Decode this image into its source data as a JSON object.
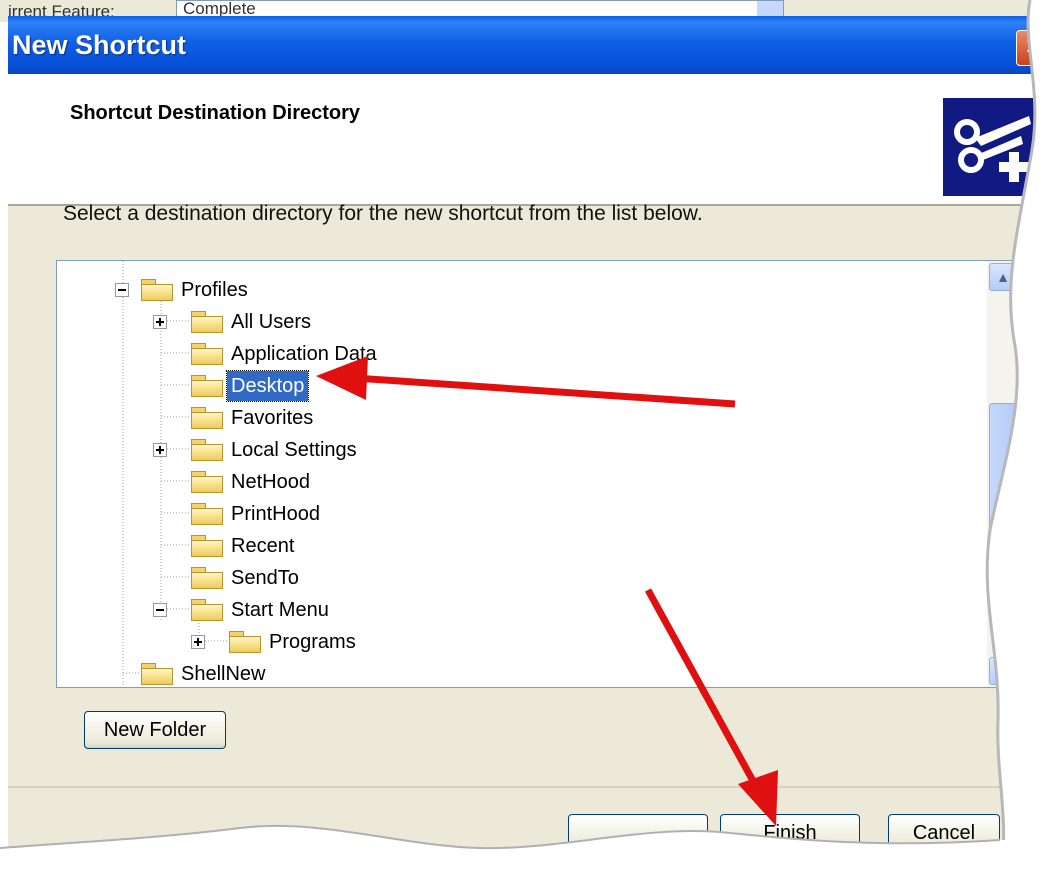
{
  "background": {
    "label": "irrent Feature:",
    "combo_value": "Complete"
  },
  "window": {
    "title": "New Shortcut",
    "close_glyph": "✕"
  },
  "header": {
    "title": "Shortcut Destination Directory",
    "icon": "shortcut-scissors-plus-icon"
  },
  "instruction": "Select a destination directory for the new shortcut from the list below.",
  "tree": {
    "nodes": [
      {
        "label": "Profiles",
        "expander": "minus",
        "selected": false
      },
      {
        "label": "All Users",
        "expander": "plus",
        "selected": false
      },
      {
        "label": "Application Data",
        "expander": "none",
        "selected": false
      },
      {
        "label": "Desktop",
        "expander": "none",
        "selected": true
      },
      {
        "label": "Favorites",
        "expander": "none",
        "selected": false
      },
      {
        "label": "Local Settings",
        "expander": "plus",
        "selected": false
      },
      {
        "label": "NetHood",
        "expander": "none",
        "selected": false
      },
      {
        "label": "PrintHood",
        "expander": "none",
        "selected": false
      },
      {
        "label": "Recent",
        "expander": "none",
        "selected": false
      },
      {
        "label": "SendTo",
        "expander": "none",
        "selected": false
      },
      {
        "label": "Start Menu",
        "expander": "minus",
        "selected": false
      },
      {
        "label": "Programs",
        "expander": "plus",
        "selected": false
      },
      {
        "label": "ShellNew",
        "expander": "none",
        "selected": false
      }
    ]
  },
  "buttons": {
    "new_folder": "New Folder",
    "back": "",
    "finish": "Finish",
    "cancel": "Cancel"
  },
  "colors": {
    "selection": "#316ac5",
    "title_bar": "#0a5fe8",
    "arrow": "#e01010"
  }
}
